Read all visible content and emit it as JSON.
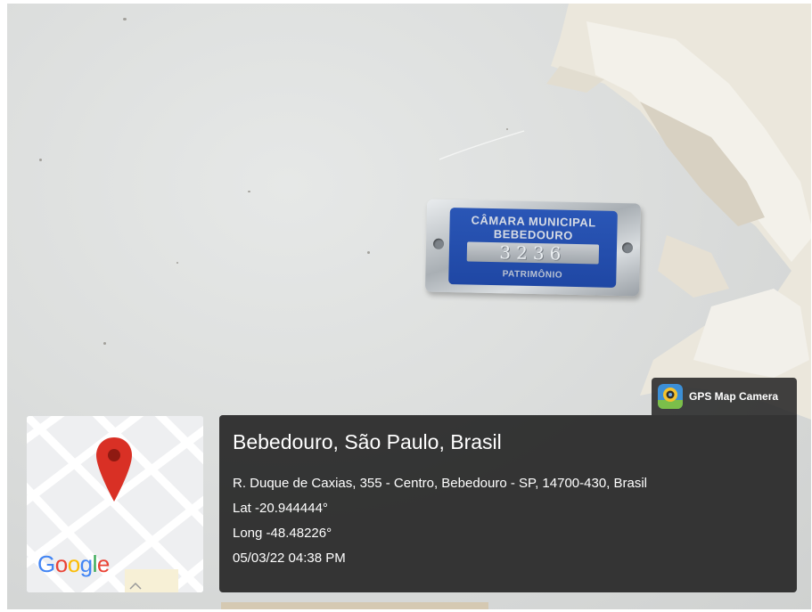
{
  "tag": {
    "line1": "CÂMARA MUNICIPAL",
    "line2": "BEBEDOURO",
    "number": "3236",
    "line4": "PATRIMÔNIO"
  },
  "badge": {
    "label": "GPS Map Camera",
    "icon": "gps-map-camera-app-icon"
  },
  "map": {
    "logo": {
      "G": "G",
      "o1": "o",
      "o2": "o",
      "g": "g",
      "l": "l",
      "e": "e"
    },
    "pin_icon": "map-pin-icon",
    "pin_color": "#d93025"
  },
  "info": {
    "title": "Bebedouro, São Paulo, Brasil",
    "address": "R. Duque de Caxias, 355 - Centro, Bebedouro - SP, 14700-430, Brasil",
    "lat": "Lat -20.944444°",
    "long": "Long -48.48226°",
    "datetime": "05/03/22 04:38 PM"
  },
  "colors": {
    "panel": "#262626",
    "tag_blue": "#2a56b6"
  }
}
